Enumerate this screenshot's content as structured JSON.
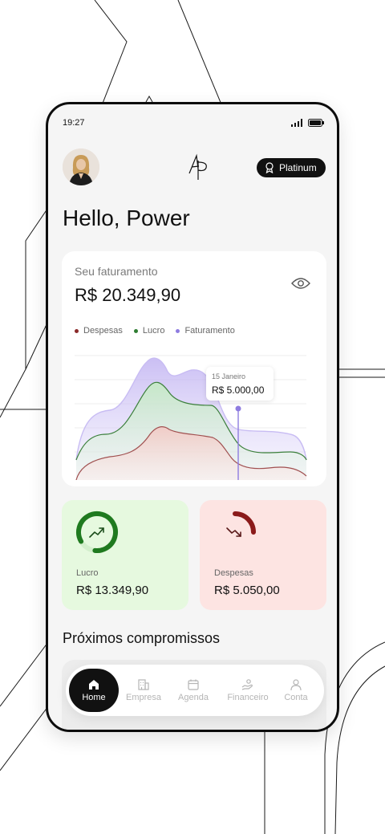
{
  "status_bar": {
    "time": "19:27"
  },
  "header": {
    "badge_label": "Platinum",
    "greeting": "Hello, Power"
  },
  "revenue": {
    "label": "Seu faturamento",
    "value": "R$ 20.349,90"
  },
  "chart_data": {
    "type": "area",
    "legend": [
      {
        "name": "Despesas",
        "color": "#8a2a2a"
      },
      {
        "name": "Lucro",
        "color": "#2e7d32"
      },
      {
        "name": "Faturamento",
        "color": "#8e7ce0"
      }
    ],
    "tooltip": {
      "date": "15 Janeiro",
      "value": "R$ 5.000,00"
    },
    "grid": true
  },
  "stats": {
    "profit": {
      "label": "Lucro",
      "value": "R$ 13.349,90",
      "ring_fraction": 0.85,
      "color": "#1f7a1f"
    },
    "expense": {
      "label": "Despesas",
      "value": "R$ 5.050,00",
      "ring_fraction": 0.25,
      "color": "#8b1a1a"
    }
  },
  "section": {
    "title": "Próximos compromissos"
  },
  "nav": {
    "items": [
      {
        "label": "Home",
        "icon": "home-icon",
        "active": true
      },
      {
        "label": "Empresa",
        "icon": "building-icon"
      },
      {
        "label": "Agenda",
        "icon": "calendar-icon"
      },
      {
        "label": "Financeiro",
        "icon": "hand-coins-icon"
      },
      {
        "label": "Conta",
        "icon": "user-icon"
      }
    ]
  },
  "colors": {
    "accent_dark": "#111111",
    "profit_bg": "#e6f9df",
    "expense_bg": "#fde4e2",
    "faturamento": "#8e7ce0",
    "lucro": "#2e7d32",
    "despesas": "#8a2a2a"
  }
}
